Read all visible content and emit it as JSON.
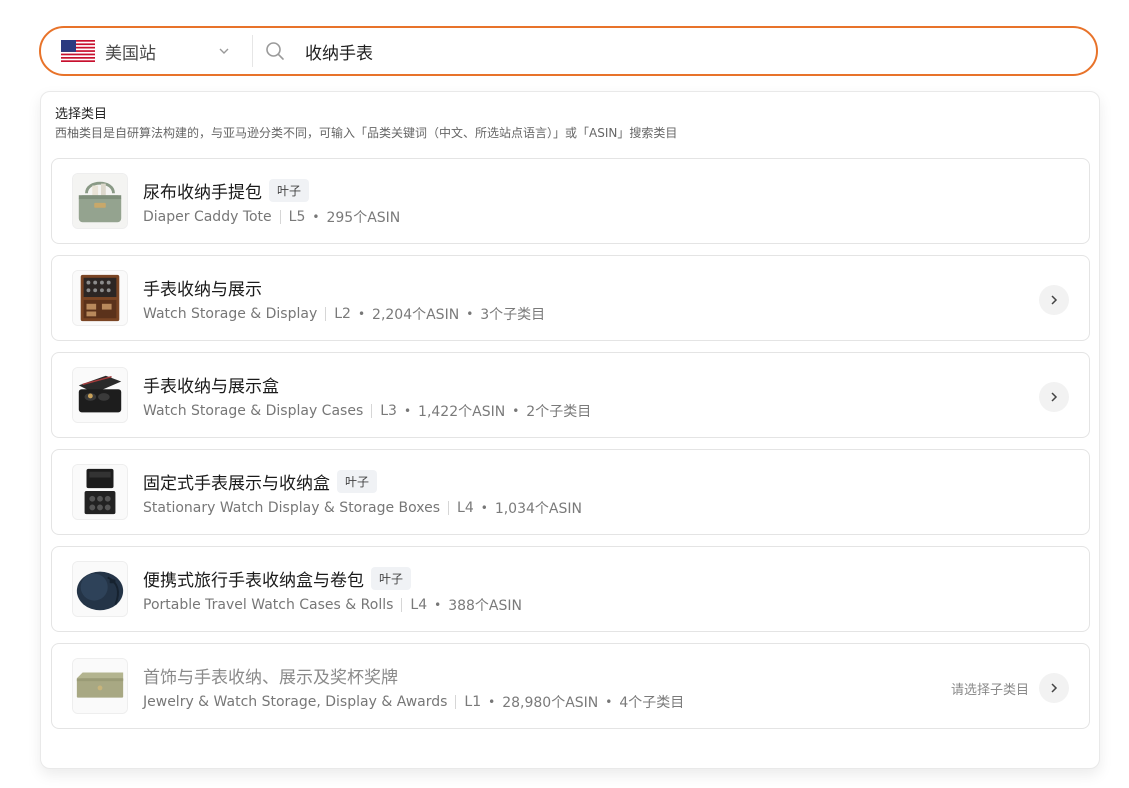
{
  "search": {
    "site_label": "美国站",
    "query": "收纳手表"
  },
  "panel": {
    "title": "选择类目",
    "subtitle": "西柚类目是自研算法构建的，与亚马逊分类不同，可输入「品类关键词（中文、所选站点语言）」或「ASIN」搜索类目"
  },
  "categories": [
    {
      "name": "尿布收纳手提包",
      "badge": "叶子",
      "en": "Diaper Caddy Tote",
      "level": "L5",
      "asin": "295个ASIN",
      "children": "",
      "hint": "",
      "icon": "diaper-tote-image"
    },
    {
      "name": "手表收纳与展示",
      "badge": "",
      "en": "Watch Storage & Display",
      "level": "L2",
      "asin": "2,204个ASIN",
      "children": "3个子类目",
      "hint": "",
      "icon": "watch-storage-image"
    },
    {
      "name": "手表收纳与展示盒",
      "badge": "",
      "en": "Watch Storage & Display Cases",
      "level": "L3",
      "asin": "1,422个ASIN",
      "children": "2个子类目",
      "hint": "",
      "icon": "watch-case-image"
    },
    {
      "name": "固定式手表展示与收纳盒",
      "badge": "叶子",
      "en": "Stationary Watch Display & Storage Boxes",
      "level": "L4",
      "asin": "1,034个ASIN",
      "children": "",
      "hint": "",
      "icon": "stationary-box-image"
    },
    {
      "name": "便携式旅行手表收纳盒与卷包",
      "badge": "叶子",
      "en": "Portable Travel Watch Cases & Rolls",
      "level": "L4",
      "asin": "388个ASIN",
      "children": "",
      "hint": "",
      "icon": "travel-case-image"
    },
    {
      "name": "首饰与手表收纳、展示及奖杯奖牌",
      "badge": "",
      "en": "Jewelry & Watch Storage, Display & Awards",
      "level": "L1",
      "asin": "28,980个ASIN",
      "children": "4个子类目",
      "hint": "请选择子类目",
      "icon": "jewelry-box-image"
    }
  ],
  "colors": {
    "accent": "#e8732a",
    "border": "#e4e4e4",
    "muted": "#8a8a8a"
  }
}
